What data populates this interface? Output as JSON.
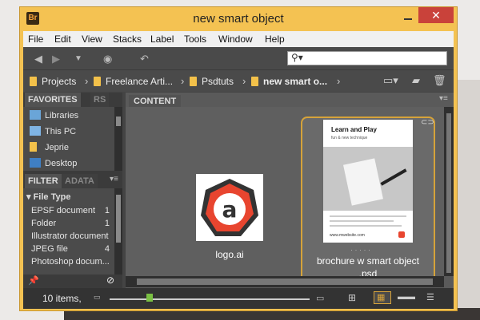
{
  "window": {
    "title": "new smart object",
    "app_badge": "Br",
    "close_glyph": "✕"
  },
  "menu": [
    "File",
    "Edit",
    "View",
    "Stacks",
    "Label",
    "Tools",
    "Window",
    "Help"
  ],
  "path": [
    {
      "label": "Projects"
    },
    {
      "label": "Freelance Arti..."
    },
    {
      "label": "Psdtuts"
    },
    {
      "label": "new smart o..."
    }
  ],
  "search": {
    "placeholder": ""
  },
  "favorites": {
    "tab": "FAVORITES",
    "tab2": "RS",
    "items": [
      "Libraries",
      "This PC",
      "Jeprie",
      "Desktop"
    ]
  },
  "filter": {
    "tab": "FILTER",
    "tab2": "ADATA",
    "heading": "File Type",
    "rows": [
      {
        "label": "EPSF document",
        "count": "1"
      },
      {
        "label": "Folder",
        "count": "1"
      },
      {
        "label": "Illustrator document",
        "count": ""
      },
      {
        "label": "JPEG file",
        "count": "4"
      },
      {
        "label": "Photoshop docum...",
        "count": ""
      }
    ]
  },
  "content": {
    "tab": "CONTENT",
    "items": [
      {
        "caption": "logo.ai",
        "glyph": "a"
      },
      {
        "caption": "brochure w smart object",
        "caption2": ".psd"
      }
    ],
    "brochure": {
      "headline": "Learn and Play",
      "sub": "fun & new technique",
      "site": "www.mwebsite.com"
    }
  },
  "status": {
    "text": "10 items,"
  },
  "colors": {
    "accent": "#d6a33a",
    "titlebar": "#f4c252",
    "close": "#c9423a",
    "logo_red": "#e8452f",
    "logo_dark": "#333333"
  }
}
